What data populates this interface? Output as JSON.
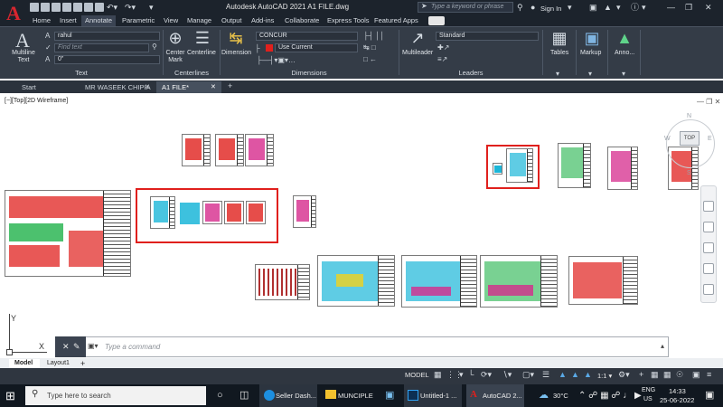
{
  "titlebar": {
    "logo": "A",
    "title": "Autodesk AutoCAD 2021    A1 FILE.dwg",
    "search_placeholder": "Type a keyword or phrase",
    "sign_in": "Sign In"
  },
  "ribbon_tabs": [
    "Home",
    "Insert",
    "Annotate",
    "Parametric",
    "View",
    "Manage",
    "Output",
    "Add-ins",
    "Collaborate",
    "Express Tools",
    "Featured Apps"
  ],
  "ribbon": {
    "text_panel": {
      "big_button": "Multiline\nText",
      "style": "rahul",
      "find": "Find text",
      "height": "0\"",
      "title": "Text"
    },
    "centerlines_panel": {
      "center_mark": "Center\nMark",
      "centerline": "Centerline",
      "title": "Centerlines"
    },
    "dimensions_panel": {
      "dimension": "Dimension",
      "style": "CONCUR",
      "layer": "Use Current",
      "title": "Dimensions"
    },
    "leaders_panel": {
      "multileader": "Multileader",
      "style": "Standard",
      "title": "Leaders"
    },
    "tables_panel": {
      "label": "Tables"
    },
    "markup_panel": {
      "label": "Markup"
    },
    "annotation_panel": {
      "label": "Anno..."
    }
  },
  "file_tabs": [
    "Start",
    "MR WASEEK CHIPIA",
    "A1 FILE*"
  ],
  "view_label": "[−][Top][2D Wireframe]",
  "viewcube": {
    "top": "TOP",
    "n": "N",
    "s": "S",
    "w": "W",
    "e": "E"
  },
  "ucs": {
    "x": "X",
    "y": "Y"
  },
  "command_placeholder": "Type a command",
  "layout_tabs": [
    "Model",
    "Layout1"
  ],
  "status": {
    "model": "MODEL"
  },
  "taskbar": {
    "search": "Type here to search",
    "apps": [
      "Seller Dash...",
      "MUNCIPLE",
      "Untitled-1 ...",
      "AutoCAD 2..."
    ],
    "weather": "30°C",
    "lang": "ENG",
    "region": "US",
    "time": "14:33",
    "date": "25-06-2022"
  },
  "colors": {
    "accent_red": "#e0201d",
    "titlebar": "#1c232c",
    "ribbon": "#343c47"
  }
}
